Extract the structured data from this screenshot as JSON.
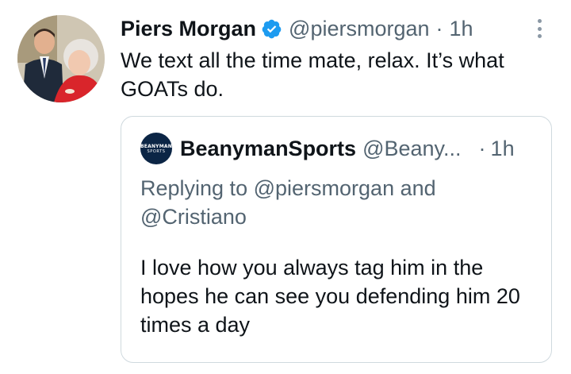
{
  "tweet": {
    "display_name": "Piers Morgan",
    "verified_icon": "verified-badge-icon",
    "handle": "@piersmorgan",
    "separator": "·",
    "time": "1h",
    "text": "We text all the time mate, relax. It’s what GOATs do.",
    "more_icon": "more-vertical-icon"
  },
  "quote": {
    "avatar_line1": "BEANYMAN",
    "avatar_line2": "SPORTS",
    "display_name": "BeanymanSports",
    "handle": "@Beany...",
    "separator": "·",
    "time": "1h",
    "replying_prefix": "Replying to",
    "replying_user1": "@piersmorgan",
    "replying_and": "and",
    "replying_user2": "@Cristiano",
    "text": "I love how you always tag him in the hopes he can see you defending him 20 times a day"
  },
  "colors": {
    "text": "#0f1419",
    "secondary": "#536471",
    "verified": "#1d9bf0",
    "border": "#cfd9de"
  }
}
